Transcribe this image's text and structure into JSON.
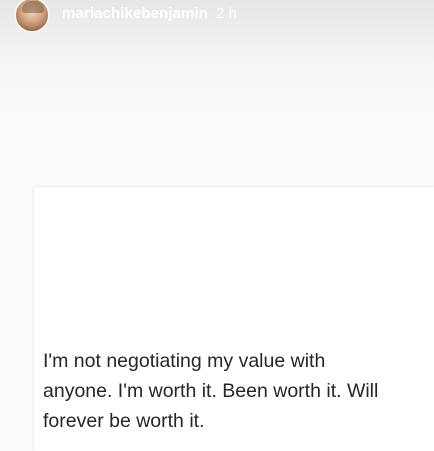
{
  "story": {
    "author": {
      "username": "mariachikebenjamin",
      "time_ago": "2 h",
      "avatar": "profile-photo"
    },
    "post": {
      "text": "I'm not negotiating my value with\nanyone. I'm worth it. Been worth it. Will\nforever be worth it."
    }
  }
}
